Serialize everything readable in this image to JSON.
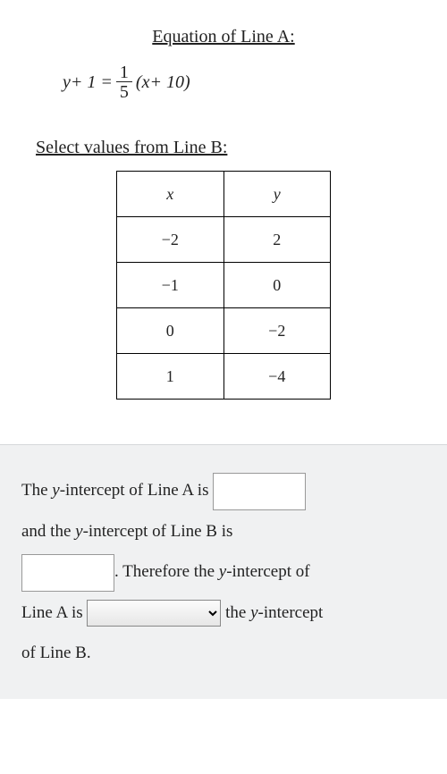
{
  "headingA": "Equation of Line A:",
  "equation": {
    "lhs_pre": "y",
    "lhs_op": " + 1 = ",
    "frac_num": "1",
    "frac_den": "5",
    "rhs_open": "(",
    "rhs_x": "x",
    "rhs_rest": " + 10)"
  },
  "headingB": "Select values from Line B:",
  "table": {
    "col1": "x",
    "col2": "y",
    "rows": [
      {
        "x": "−2",
        "y": "2"
      },
      {
        "x": "−1",
        "y": "0"
      },
      {
        "x": "0",
        "y": "−2"
      },
      {
        "x": "1",
        "y": "−4"
      }
    ]
  },
  "answer": {
    "p1a": "The ",
    "p1var": "y",
    "p1b": "-intercept of Line A is ",
    "p2a": "and the ",
    "p2var": "y",
    "p2b": "-intercept of Line B is",
    "p3a": ". Therefore the ",
    "p3var": "y",
    "p3b": "-intercept of",
    "p4a": "Line A is ",
    "p4b": " the ",
    "p4var": "y",
    "p4c": "-intercept",
    "p5": "of Line B."
  },
  "inputs": {
    "blankA": "",
    "blankB": "",
    "compare_placeholder": ""
  }
}
